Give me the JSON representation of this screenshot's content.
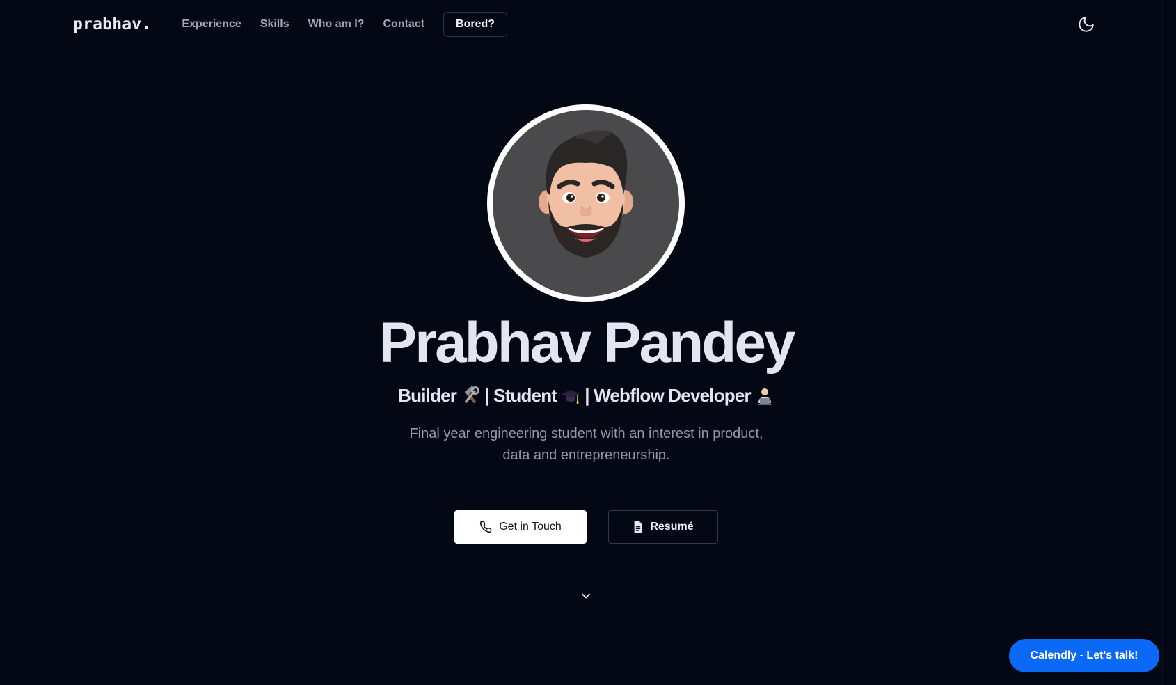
{
  "nav": {
    "logo": "prabhav.",
    "links": [
      "Experience",
      "Skills",
      "Who am I?",
      "Contact"
    ],
    "bored_label": "Bored?",
    "theme_icon": "moon-icon"
  },
  "hero": {
    "name": "Prabhav Pandey",
    "roles": [
      {
        "label": "Builder",
        "icon": "hammer-wrench-icon"
      },
      {
        "label": "| Student",
        "icon": "graduation-cap-icon"
      },
      {
        "label": "| Webflow Developer",
        "icon": "technologist-icon"
      }
    ],
    "description": "Final year engineering student with an interest in product, data and entrepreneurship.",
    "get_in_touch_label": "Get in Touch",
    "resume_label": "Resumé",
    "scroll_icon": "chevron-down-icon"
  },
  "calendly": {
    "label": "Calendly - Let's talk!"
  },
  "colors": {
    "background": "#040815",
    "accent": "#0a69f5",
    "text": "#e3e6f1",
    "muted": "#9499a8"
  }
}
